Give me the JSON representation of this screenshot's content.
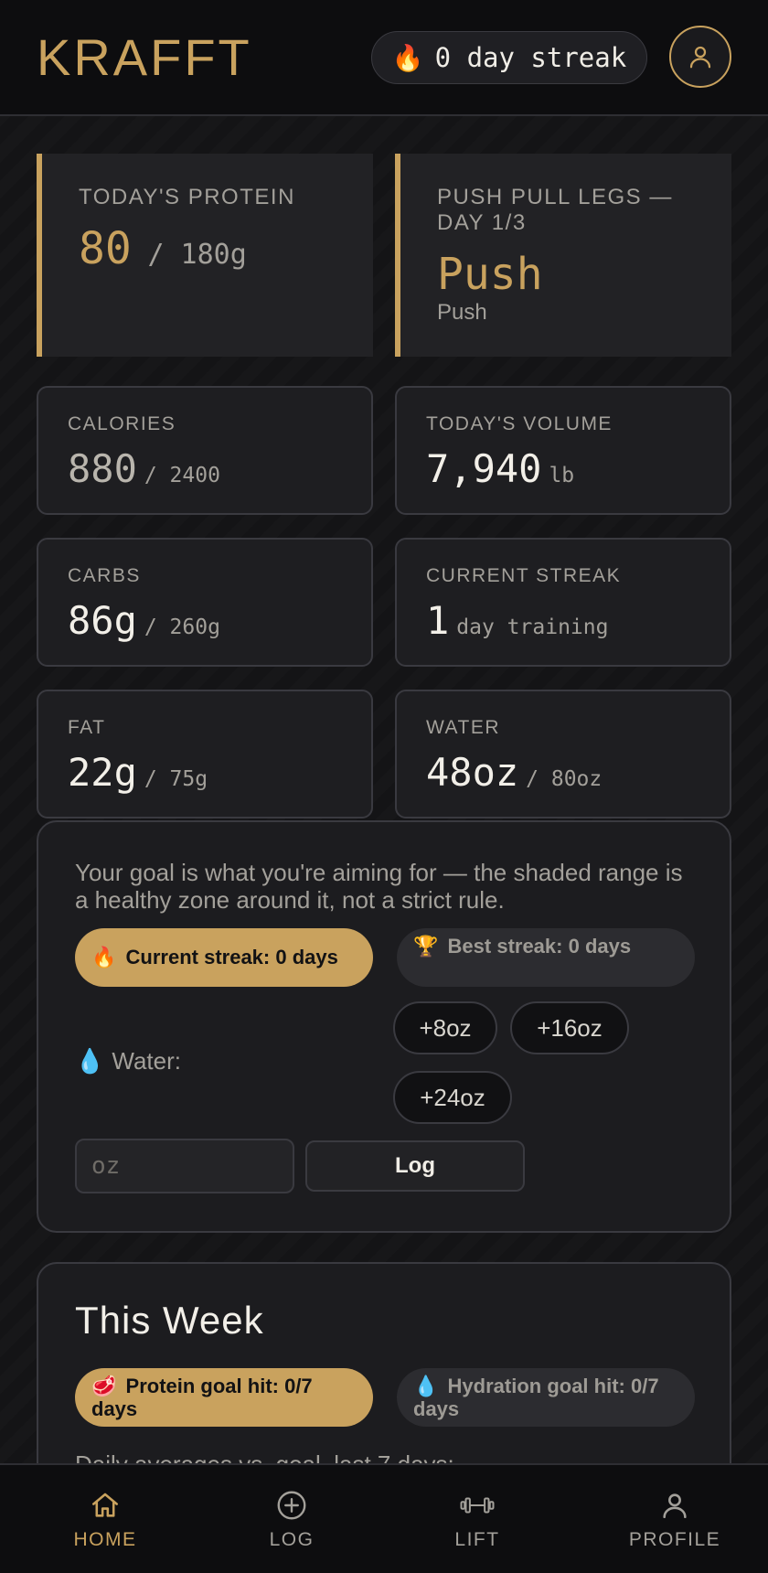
{
  "app": {
    "title": "KRAFFT"
  },
  "header": {
    "streak_icon": "🔥",
    "streak_text": "0 day streak",
    "avatar_icon": "user-icon"
  },
  "hero": {
    "protein": {
      "label": "TODAY'S PROTEIN",
      "value": "80",
      "target": "/ 180g"
    },
    "split": {
      "label": "PUSH PULL LEGS — DAY 1/3",
      "value": "Push",
      "sub": "Push"
    }
  },
  "stats": {
    "calories": {
      "label": "CALORIES",
      "value": "880",
      "target": "/ 2400"
    },
    "volume": {
      "label": "TODAY'S VOLUME",
      "value": "7,940",
      "target": "lb"
    },
    "carbs": {
      "label": "CARBS",
      "value": "86g",
      "target": "/ 260g"
    },
    "streak": {
      "label": "CURRENT STREAK",
      "value": "1",
      "target": "day training"
    },
    "fat": {
      "label": "FAT",
      "value": "22g",
      "target": "/ 75g"
    },
    "water": {
      "label": "WATER",
      "value": "48oz",
      "target": "/ 80oz"
    }
  },
  "water_panel": {
    "note": "Your goal is what you're aiming for — the shaded range is a healthy zone around it, not a strict rule.",
    "current_streak": {
      "icon": "🔥",
      "text": "Current streak: 0 days"
    },
    "best_streak": {
      "icon": "🏆",
      "text": "Best streak: 0 days"
    },
    "water_icon": "💧",
    "water_label": "Water:",
    "quick_add": [
      "+8oz",
      "+16oz",
      "+24oz"
    ],
    "input_placeholder": "oz",
    "log_label": "Log"
  },
  "week": {
    "title": "This Week",
    "protein_goal": {
      "icon": "🥩",
      "text": "Protein goal hit: 0/7 days"
    },
    "hydration_goal": {
      "icon": "💧",
      "text": "Hydration goal hit: 0/7 days"
    },
    "averages_label": "Daily averages vs. goal, last 7 days:"
  },
  "nav": [
    {
      "label": "HOME",
      "icon": "home-icon",
      "active": true
    },
    {
      "label": "LOG",
      "icon": "plus-circle-icon",
      "active": false
    },
    {
      "label": "LIFT",
      "icon": "dumbbell-icon",
      "active": false
    },
    {
      "label": "PROFILE",
      "icon": "user-icon",
      "active": false
    }
  ],
  "colors": {
    "accent": "#c9a25e",
    "background": "#141416",
    "card": "#1e1e21",
    "muted_text": "#a3a09a"
  }
}
